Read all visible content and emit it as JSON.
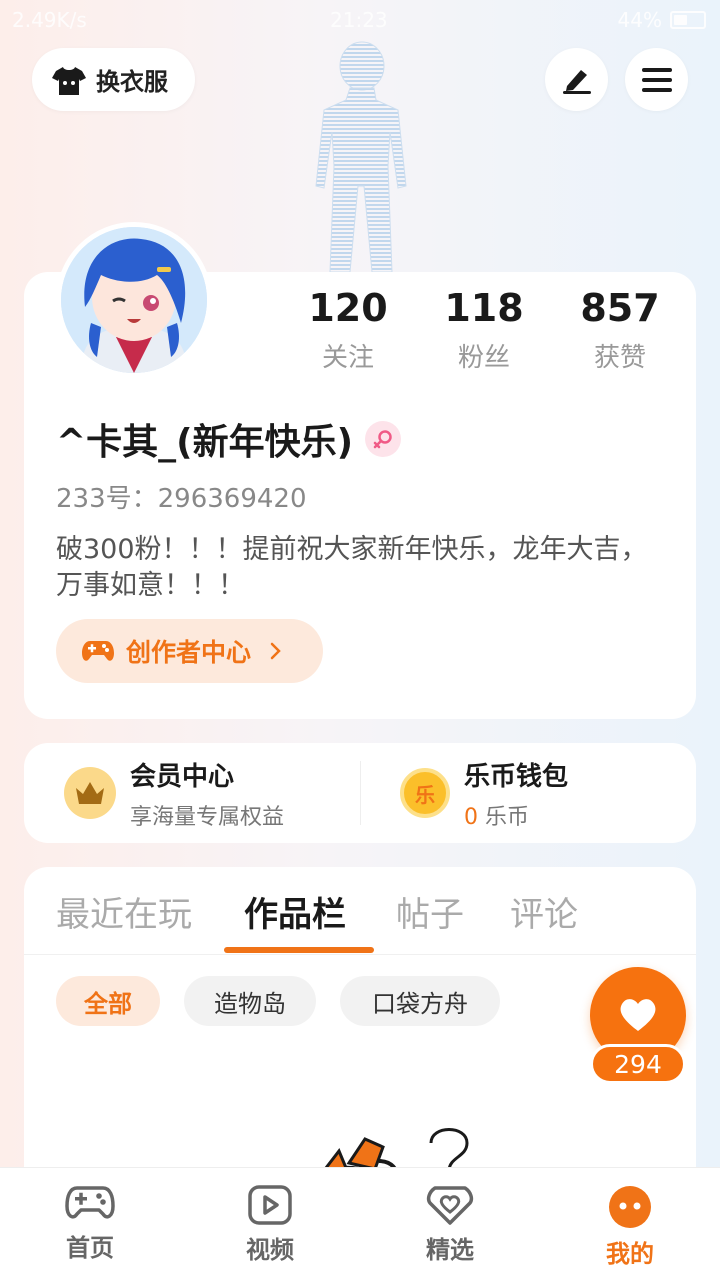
{
  "status_bar": {
    "network_speed": "2.49K/s",
    "time": "21:23",
    "battery": "44%",
    "battery_level": 0.44
  },
  "header": {
    "outfit_label": "换衣服"
  },
  "profile": {
    "stats": [
      {
        "value": "120",
        "label": "关注"
      },
      {
        "value": "118",
        "label": "粉丝"
      },
      {
        "value": "857",
        "label": "获赞"
      }
    ],
    "username": "^卡其_(新年快乐)",
    "uid": "233号：296369420",
    "bio": "破300粉！！！提前祝大家新年快乐，龙年大吉，万事如意！！！",
    "creator_center_label": "创作者中心"
  },
  "member": {
    "title": "会员中心",
    "subtitle": "享海量专属权益"
  },
  "wallet": {
    "title": "乐币钱包",
    "balance": "0",
    "unit": "乐币",
    "icon_char": "乐"
  },
  "tabs": [
    "最近在玩",
    "作品栏",
    "帖子",
    "评论"
  ],
  "filters": [
    "全部",
    "造物岛",
    "口袋方舟"
  ],
  "like": {
    "count": "294"
  },
  "bottom_nav": [
    {
      "label": "首页",
      "icon": "gamepad-icon"
    },
    {
      "label": "视频",
      "icon": "video-icon"
    },
    {
      "label": "精选",
      "icon": "heart-shield-icon"
    },
    {
      "label": "我的",
      "icon": "profile-face-icon"
    }
  ],
  "colors": {
    "accent": "#f07317",
    "accent_light": "#fde9dc"
  }
}
